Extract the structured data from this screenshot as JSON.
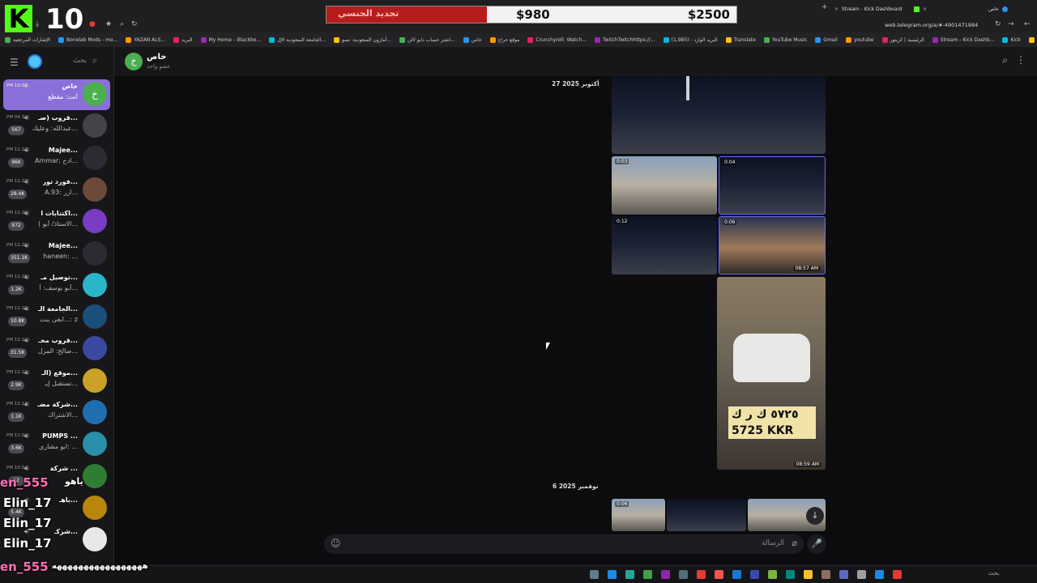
{
  "stream_overlay": {
    "kick_logo": "K",
    "viewer_count": "10",
    "donation": {
      "label": "تجديد الجنسي",
      "current": "$980",
      "goal": "$2500",
      "progress_fraction": 0.392
    },
    "chat_overlay": {
      "line1_name": "en_555",
      "line1_text": "ياهو",
      "line2_name": "Elin_17",
      "line3_name": "Elin_17",
      "line4_name": "Elin_17",
      "line5_name": "en_555",
      "line5_text": "هههههههههههههههههه"
    }
  },
  "browser": {
    "tabs": [
      {
        "label": "Stream - Kick Dashboard"
      },
      {
        "label": "خاص"
      }
    ],
    "url": "web.telegram.org/a/#-4901471984",
    "bookmarks": [
      "الإشارات المرجعية",
      "Bonelab Mods - mo...",
      "YAZAN ALS...",
      "البريد",
      "My Home – Blackbo...",
      "الجامعة السعودية الإل...",
      "أمازون السعودية: تسو...",
      "اشتر حساب دايو لالن...",
      "خاص",
      "موقع حراج",
      "Crunchyroll: Watch...",
      "TwitchTwitchhttps://...",
      "البريد الوارد - (1,985)",
      "Translate",
      "YouTube Music",
      "Gmail",
      "youtube",
      "الرئيسية | كريتور",
      "Stream - Kick Dashb...",
      "Kick",
      "Google"
    ]
  },
  "sidebar": {
    "search_placeholder": "بحث",
    "chats": [
      {
        "name": "خاص",
        "time": "PM 10:58",
        "message": "أنت: مقطع",
        "badge": "",
        "color": "#4caf50",
        "letter": "خ",
        "active": true
      },
      {
        "name": "قروب (صـ...",
        "time": "PM 04:32",
        "message": "عبدالله: وعليك...",
        "badge": "567",
        "color": "#444448",
        "letter": "",
        "active": false
      },
      {
        "name": "Majee...",
        "time": "PM 11:27",
        "message": "Ammar: ادخ...",
        "badge": "96K",
        "color": "#2b2b33",
        "letter": "",
        "active": false
      },
      {
        "name": "فورد تور...",
        "time": "PM 11:27",
        "message": "A.93: ارر...",
        "badge": "28.4K",
        "color": "#6b4a3a",
        "letter": "",
        "active": false
      },
      {
        "name": "اكتتابات ا...",
        "time": "PM 11:26",
        "message": "( الاستاذ/ أبو...",
        "badge": "972",
        "color": "#7a3cc2",
        "letter": "",
        "active": false
      },
      {
        "name": "Majee...",
        "time": "PM 11:25",
        "message": "haneen: ...",
        "badge": "351.1K",
        "color": "#2b2b33",
        "letter": "",
        "active": false
      },
      {
        "name": "توصيل مـ...",
        "time": "PM 11:25",
        "message": "أبو يوسف: أ...",
        "badge": "1.2K",
        "color": "#29b6c8",
        "letter": "",
        "active": false
      },
      {
        "name": "الجامعة الـ...",
        "time": "PM 11:20",
        "message": "ابغى بنت...: z",
        "badge": "10.8K",
        "color": "#1a4f7a",
        "letter": "",
        "active": false
      },
      {
        "name": "قروب مخـ...",
        "time": "PM 11:19",
        "message": "صالح: المزل...",
        "badge": "31.5K",
        "color": "#3b4aa0",
        "letter": "",
        "active": false
      },
      {
        "name": "موقع (الـ...",
        "time": "PM 11:19",
        "message": "تستقبل إيـ...",
        "badge": "2.9K",
        "color": "#c9a227",
        "letter": "",
        "active": false
      },
      {
        "name": "شركة مضـ...",
        "time": "PM 11:13",
        "message": "الاشتراك...",
        "badge": "1.1K",
        "color": "#1f6fb0",
        "letter": "",
        "active": false
      },
      {
        "name": "PUMPS ...",
        "time": "PM 11:04",
        "message": "ابو مشاري: ...",
        "badge": "3.6K",
        "color": "#2a8fa8",
        "letter": "",
        "active": false
      },
      {
        "name": "شركة ...",
        "time": "PM 10:54",
        "message": "",
        "badge": "12",
        "color": "#2e7d32",
        "letter": "",
        "active": false
      },
      {
        "name": "باهـ...",
        "time": "",
        "message": "",
        "badge": "5.4K",
        "color": "#b8860b",
        "letter": "",
        "active": false
      },
      {
        "name": "شركـ...",
        "time": "",
        "message": "",
        "badge": "",
        "color": "#e8e8e8",
        "letter": "",
        "active": false
      }
    ]
  },
  "header": {
    "title": "خاص",
    "subtitle": "عضو واحد",
    "avatar_letter": "خ"
  },
  "messages": {
    "date1": "27 أكتوبر 2025",
    "date2": "6 نوفمبر 2025",
    "album1": {
      "videos": [
        "0:03",
        "0:04",
        "0:12",
        "0:06"
      ],
      "time": "08:57 AM"
    },
    "photo": {
      "plate_top": "٥٧٢٥ ك ر ك",
      "plate_bottom": "5725 KKR",
      "time": "08:59 AM"
    },
    "album2": {
      "video_time": "0:06"
    }
  },
  "composer": {
    "placeholder": "الرسالة"
  },
  "taskbar": {
    "search_label": "بحث"
  }
}
